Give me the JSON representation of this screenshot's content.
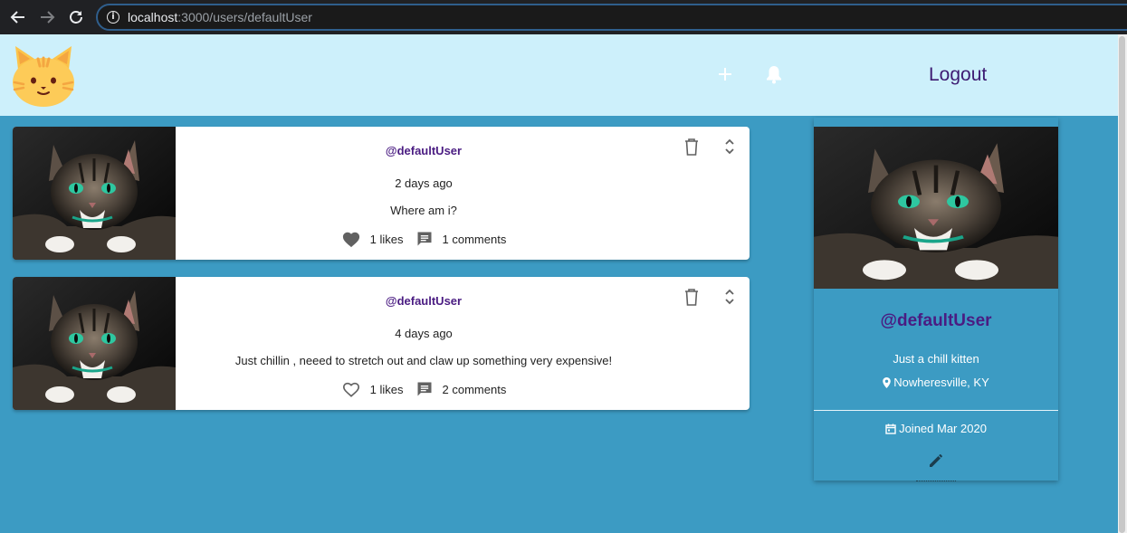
{
  "browser": {
    "url_host": "localhost",
    "url_path": ":3000/users/defaultUser",
    "icons": [
      "back-arrow-icon",
      "forward-arrow-icon",
      "reload-icon",
      "info-icon"
    ]
  },
  "header": {
    "logo": "cat-face-logo",
    "plus_icon": "plus-icon",
    "bell_icon": "bell-icon",
    "logout_label": "Logout",
    "background": "#cdf0fb"
  },
  "posts": [
    {
      "username": "@defaultUser",
      "time": "2 days ago",
      "body": "Where am i?",
      "likes": "1 likes",
      "comments": "1 comments",
      "liked": true
    },
    {
      "username": "@defaultUser",
      "time": "4 days ago",
      "body": "Just chillin , neeed to stretch out and claw up something very expensive!",
      "likes": "1 likes",
      "comments": "2 comments",
      "liked": false
    }
  ],
  "profile": {
    "username": "@defaultUser",
    "bio": "Just a chill kitten",
    "location": "Nowheresville, KY",
    "joined": "Joined Mar 2020"
  },
  "colors": {
    "page_background": "#3c9bc3",
    "accent_purple": "#4a1c82",
    "logout_purple": "#3d1b72"
  }
}
